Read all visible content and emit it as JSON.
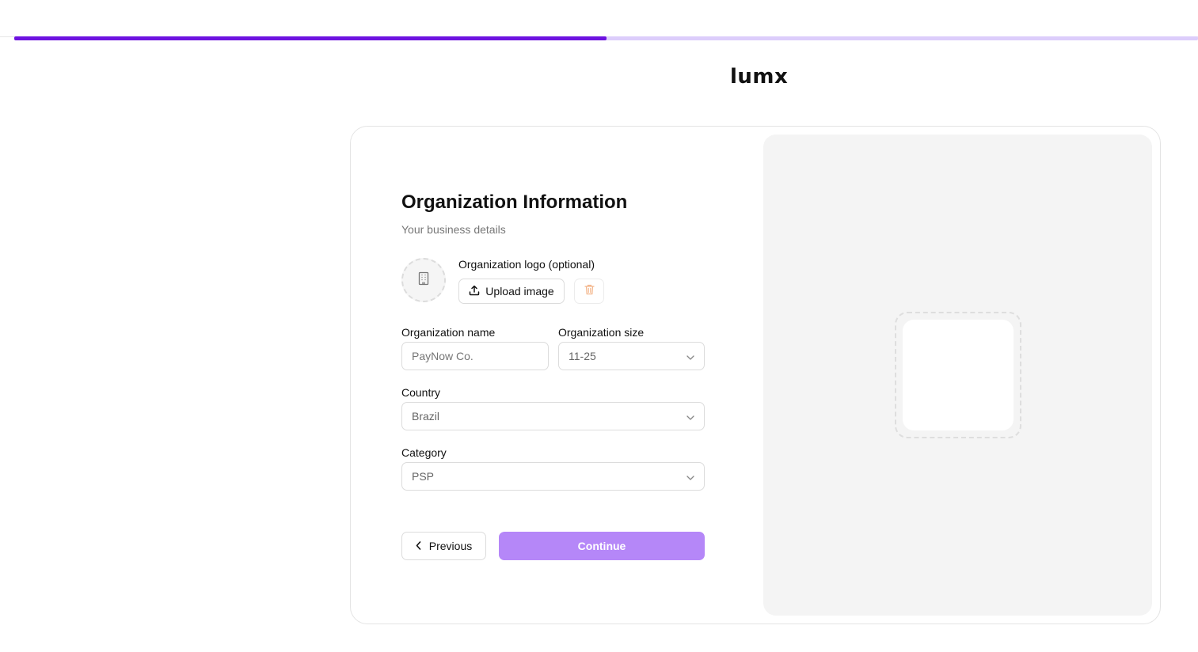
{
  "progress": {
    "fraction": 0.5
  },
  "brand": {
    "name": "lumx"
  },
  "form": {
    "title": "Organization Information",
    "subtitle": "Your business details",
    "logo": {
      "label": "Organization logo (optional)",
      "upload_label": "Upload image",
      "placeholder_icon": "building-icon",
      "upload_icon": "upload-icon",
      "delete_icon": "trash-icon"
    },
    "org_name": {
      "label": "Organization name",
      "placeholder": "PayNow Co.",
      "value": ""
    },
    "org_size": {
      "label": "Organization size",
      "value": "11-25"
    },
    "country": {
      "label": "Country",
      "value": "Brazil"
    },
    "category": {
      "label": "Category",
      "value": "PSP"
    },
    "previous_label": "Previous",
    "continue_label": "Continue"
  },
  "colors": {
    "accent": "#6d12e0",
    "accent_light": "#dccdfb",
    "continue_button": "#b587f8",
    "delete_icon": "#f3b58a"
  }
}
